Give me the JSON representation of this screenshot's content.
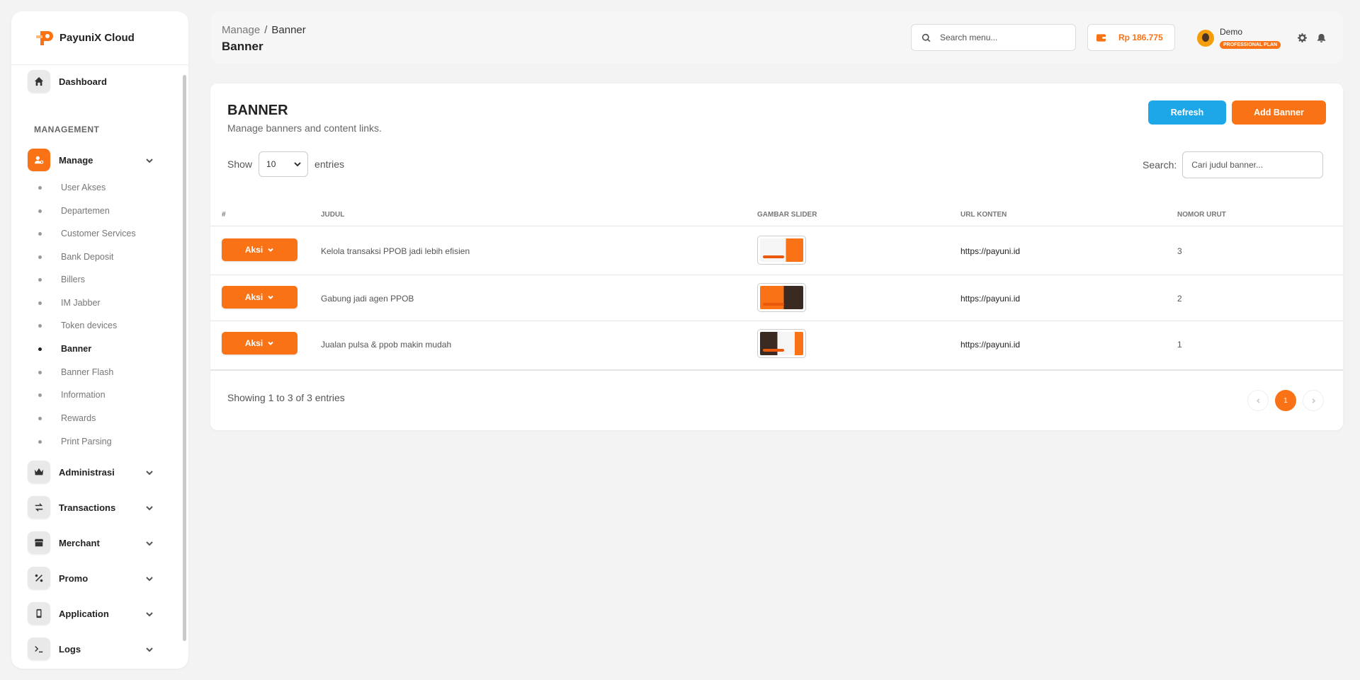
{
  "brand": {
    "name": "PayuniX Cloud"
  },
  "sidebar": {
    "dashboard": "Dashboard",
    "section_title": "MANAGEMENT",
    "manage": "Manage",
    "sub_items": [
      "User Akses",
      "Departemen",
      "Customer Services",
      "Bank Deposit",
      "Billers",
      "IM Jabber",
      "Token devices",
      "Banner",
      "Banner Flash",
      "Information",
      "Rewards",
      "Print Parsing"
    ],
    "active_sub": "Banner",
    "groups": [
      "Administrasi",
      "Transactions",
      "Merchant",
      "Promo",
      "Application",
      "Logs"
    ]
  },
  "header": {
    "breadcrumb_parent": "Manage",
    "breadcrumb_sep": "/",
    "breadcrumb_current": "Banner",
    "title": "Banner",
    "search_placeholder": "Search menu...",
    "balance": "Rp 186.775",
    "user_name": "Demo",
    "plan": "PROFESSIONAL PLAN"
  },
  "card": {
    "title": "BANNER",
    "subtitle": "Manage banners and content links.",
    "refresh_label": "Refresh",
    "add_label": "Add Banner",
    "show_label": "Show",
    "entries_value": "10",
    "entries_label": "entries",
    "search_label": "Search:",
    "search_placeholder": "Cari judul banner...",
    "columns": [
      "#",
      "JUDUL",
      "GAMBAR SLIDER",
      "URL KONTEN",
      "NOMOR URUT"
    ],
    "rows": [
      {
        "action": "Aksi",
        "judul": "Kelola transaksi PPOB jadi lebih efisien",
        "url": "https://payuni.id",
        "nomor": "3"
      },
      {
        "action": "Aksi",
        "judul": "Gabung jadi agen PPOB",
        "url": "https://payuni.id",
        "nomor": "2"
      },
      {
        "action": "Aksi",
        "judul": "Jualan pulsa & ppob makin mudah",
        "url": "https://payuni.id",
        "nomor": "1"
      }
    ],
    "showing_text": "Showing 1 to 3 of 3 entries",
    "current_page": "1"
  },
  "colors": {
    "accent": "#f97316",
    "info": "#1ea7e8"
  }
}
